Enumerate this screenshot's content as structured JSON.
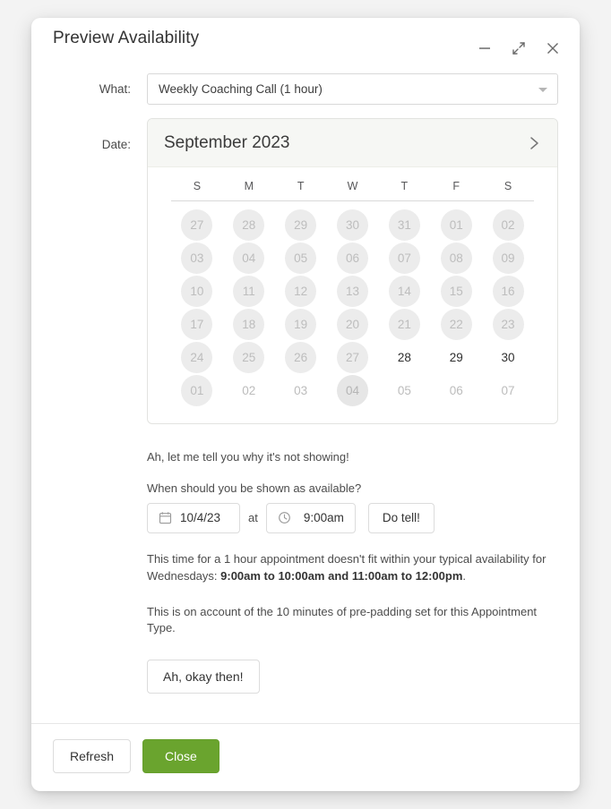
{
  "window": {
    "title": "Preview Availability",
    "controls": [
      {
        "name": "minimize-icon",
        "glyph": "minimize"
      },
      {
        "name": "expand-icon",
        "glyph": "expand"
      },
      {
        "name": "close-icon",
        "glyph": "close"
      }
    ]
  },
  "form": {
    "what_label": "What:",
    "what_value": "Weekly Coaching Call (1 hour)",
    "date_label": "Date:"
  },
  "calendar": {
    "month": "September 2023",
    "next_icon": "chevron-right-icon",
    "weekdays": [
      "S",
      "M",
      "T",
      "W",
      "T",
      "F",
      "S"
    ],
    "weeks": [
      [
        {
          "d": "27",
          "state": "disabled"
        },
        {
          "d": "28",
          "state": "disabled"
        },
        {
          "d": "29",
          "state": "disabled"
        },
        {
          "d": "30",
          "state": "disabled"
        },
        {
          "d": "31",
          "state": "disabled"
        },
        {
          "d": "01",
          "state": "disabled"
        },
        {
          "d": "02",
          "state": "disabled"
        }
      ],
      [
        {
          "d": "03",
          "state": "disabled"
        },
        {
          "d": "04",
          "state": "disabled"
        },
        {
          "d": "05",
          "state": "disabled"
        },
        {
          "d": "06",
          "state": "disabled"
        },
        {
          "d": "07",
          "state": "disabled"
        },
        {
          "d": "08",
          "state": "disabled"
        },
        {
          "d": "09",
          "state": "disabled"
        }
      ],
      [
        {
          "d": "10",
          "state": "disabled"
        },
        {
          "d": "11",
          "state": "disabled"
        },
        {
          "d": "12",
          "state": "disabled"
        },
        {
          "d": "13",
          "state": "disabled"
        },
        {
          "d": "14",
          "state": "disabled"
        },
        {
          "d": "15",
          "state": "disabled"
        },
        {
          "d": "16",
          "state": "disabled"
        }
      ],
      [
        {
          "d": "17",
          "state": "disabled"
        },
        {
          "d": "18",
          "state": "disabled"
        },
        {
          "d": "19",
          "state": "disabled"
        },
        {
          "d": "20",
          "state": "disabled"
        },
        {
          "d": "21",
          "state": "disabled"
        },
        {
          "d": "22",
          "state": "disabled"
        },
        {
          "d": "23",
          "state": "disabled"
        }
      ],
      [
        {
          "d": "24",
          "state": "disabled"
        },
        {
          "d": "25",
          "state": "disabled"
        },
        {
          "d": "26",
          "state": "disabled"
        },
        {
          "d": "27",
          "state": "disabled"
        },
        {
          "d": "28",
          "state": "available"
        },
        {
          "d": "29",
          "state": "available"
        },
        {
          "d": "30",
          "state": "available"
        }
      ],
      [
        {
          "d": "01",
          "state": "disabled"
        },
        {
          "d": "02",
          "state": "plain"
        },
        {
          "d": "03",
          "state": "plain"
        },
        {
          "d": "04",
          "state": "selected"
        },
        {
          "d": "05",
          "state": "plain"
        },
        {
          "d": "06",
          "state": "plain"
        },
        {
          "d": "07",
          "state": "plain"
        }
      ]
    ]
  },
  "explain": {
    "intro": "Ah, let me tell you why it's not showing!",
    "question": "When should you be shown as available?",
    "date_value": "10/4/23",
    "date_icon": "calendar-icon",
    "at_word": "at",
    "time_value": "9:00am",
    "time_icon": "clock-icon",
    "do_tell_label": "Do tell!",
    "reason_part1": "This time for a 1 hour appointment doesn't fit within your typical availability for Wednesdays: ",
    "reason_bold": "9:00am to 10:00am and 11:00am to 12:00pm",
    "reason_part2": ".",
    "reason_2": "This is on account of the 10 minutes of pre-padding set for this Appointment Type.",
    "okay_label": "Ah, okay then!"
  },
  "footer": {
    "refresh_label": "Refresh",
    "close_label": "Close",
    "close_color": "#6aa42e"
  }
}
